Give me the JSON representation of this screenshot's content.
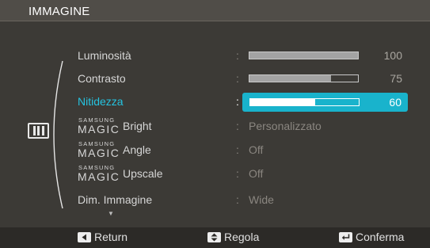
{
  "menu": {
    "title": "IMMAGINE",
    "side_icon": "picture-menu-icon",
    "items": [
      {
        "label": "Luminosità",
        "value": 100,
        "type": "slider"
      },
      {
        "label": "Contrasto",
        "value": 75,
        "type": "slider"
      },
      {
        "label": "Nitidezza",
        "value": 60,
        "type": "slider",
        "selected": true
      },
      {
        "brand_small": "SAMSUNG",
        "brand_big": "MAGIC",
        "suffix": "Bright",
        "value": "Personalizzato",
        "type": "text"
      },
      {
        "brand_small": "SAMSUNG",
        "brand_big": "MAGIC",
        "suffix": "Angle",
        "value": "Off",
        "type": "text"
      },
      {
        "brand_small": "SAMSUNG",
        "brand_big": "MAGIC",
        "suffix": "Upscale",
        "value": "Off",
        "type": "text"
      },
      {
        "label": "Dim. Immagine",
        "value": "Wide",
        "type": "text"
      }
    ],
    "colon": ":",
    "more_indicator": "▼"
  },
  "footer": {
    "return_label": "Return",
    "adjust_label": "Regola",
    "confirm_label": "Conferma"
  },
  "colors": {
    "selection": "#19b3cc",
    "selected_text": "#25c3e0",
    "background": "#3c3a36"
  }
}
